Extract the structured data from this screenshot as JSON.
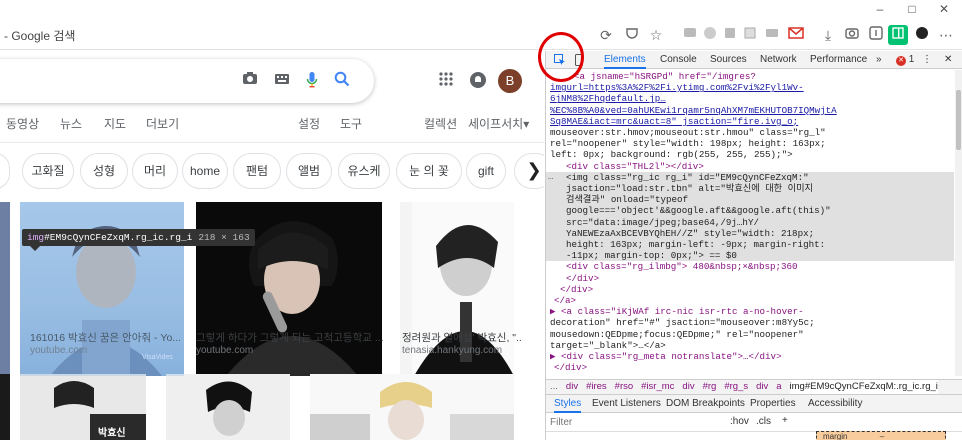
{
  "browser": {
    "url_text": "- Google 검색",
    "window_controls": [
      "–",
      "□",
      "✕"
    ]
  },
  "google": {
    "tabs": [
      "동영상",
      "뉴스",
      "지도",
      "더보기",
      "설정",
      "도구",
      "컬렉션",
      "세이프서치"
    ],
    "safesearch_arrow": "▾",
    "avatar_letter": "B",
    "chips": [
      "고화질",
      "성형",
      "머리",
      "home",
      "팬텀",
      "앨범",
      "유스케",
      "눈 의 꽃",
      "gift"
    ],
    "chip_next": "❯",
    "results": [
      {
        "caption": "161016 박효신 꿈은 안아줘 - Yo...",
        "source": "youtube.com",
        "thumb_label": "VisaVides"
      },
      {
        "caption": "그렇게 하다가 그렇게 되는 고척고등학교 ...",
        "source": "youtube.com"
      },
      {
        "caption": "정려원과 열애설' 박효신, \"...",
        "source": "tenasia.hankyung.com"
      }
    ],
    "bottom_thumb_label": "박효신",
    "tooltip": {
      "tag": "img",
      "id": "#EM9cQynCFeZxqM",
      "cls": ".rg_ic.rg_i",
      "size": "218 × 163"
    }
  },
  "devtools": {
    "tabs": [
      "Elements",
      "Console",
      "Sources",
      "Network",
      "Performance"
    ],
    "more": "»",
    "error_count": "1",
    "error_icon": "✕",
    "dom_lines": [
      {
        "kind": "a_open_1",
        "text": "<a jsname=\"hSRGPd\" href=\"/imgres?"
      },
      {
        "kind": "link",
        "text": "imgurl=https%3A%2F%2Fi.ytimg.com%2Fvi%2Fyl1Wv-"
      },
      {
        "kind": "link",
        "text": "6jNM8%2Fhqdefault.jp…"
      },
      {
        "kind": "link",
        "text": "%EC%8B%A0&ved=0ahUKEwi1rqamr5nqAhXM7mEKHUTOB7IQMwjtA"
      },
      {
        "kind": "link_tail",
        "text": "Sq8MAE&iact=mrc&uact=8\" jsaction=\"fire.ivg_o;"
      },
      {
        "kind": "plain",
        "text": "mouseover:str.hmov;mouseout:str.hmou\" class=\"rg_l\""
      },
      {
        "kind": "plain",
        "text": "rel=\"noopener\" style=\"width: 198px; height: 163px;"
      },
      {
        "kind": "plain",
        "text": "left: 0px; background: rgb(255, 255, 255);\">"
      },
      {
        "kind": "div",
        "text": "<div class=\"THL2l\"></div>"
      },
      {
        "kind": "sel",
        "text": "<img class=\"rg_ic rg_i\" id=\"EM9cQynCFeZxqM:\""
      },
      {
        "kind": "sel",
        "text": "jsaction=\"load:str.tbn\" alt=\"박효신에 대한 이미지"
      },
      {
        "kind": "sel",
        "text": "검색결과\" onload=\"typeof"
      },
      {
        "kind": "sel",
        "text": "google==='object'&&google.aft&&google.aft(this)\""
      },
      {
        "kind": "sel",
        "text": "src=\"data:image/jpeg;base64,/9j…hY/"
      },
      {
        "kind": "sel",
        "text": "YaNEWEzaAxBCEVBYQhEH//Z\" style=\"width: 218px;"
      },
      {
        "kind": "sel",
        "text": "height: 163px; margin-left: -9px; margin-right:"
      },
      {
        "kind": "sel",
        "text": "-11px; margin-top: 0px;\"> == $0"
      },
      {
        "kind": "div",
        "text": "<div class=\"rg_ilmbg\"> 480&nbsp;×&nbsp;360"
      },
      {
        "kind": "close",
        "text": "</div>"
      },
      {
        "kind": "close2",
        "text": "</div>"
      },
      {
        "kind": "close3",
        "text": "</a>"
      },
      {
        "kind": "a2",
        "text": "▶ <a class=\"iKjWAf irc-nic isr-rtc a-no-hover-"
      },
      {
        "kind": "plain2",
        "text": "decoration\" href=\"#\" jsaction=\"mouseover:m8Yy5c;"
      },
      {
        "kind": "plain2",
        "text": "mousedown:QEDpme;focus:QEDpme;\" rel=\"noopener\""
      },
      {
        "kind": "plain2",
        "text": "target=\"_blank\">…</a>"
      },
      {
        "kind": "a2",
        "text": "▶ <div class=\"rg_meta notranslate\">…</div>"
      },
      {
        "kind": "close3",
        "text": "</div>"
      }
    ],
    "breadcrumbs": [
      "...",
      "div",
      "#ires",
      "#rso",
      "#isr_mc",
      "div",
      "#rg",
      "#rg_s",
      "div",
      "a",
      "img#EM9cQynCFeZxqM:.rg_ic.rg_i"
    ],
    "bottom_tabs": [
      "Styles",
      "Event Listeners",
      "DOM Breakpoints",
      "Properties",
      "Accessibility"
    ],
    "filter_placeholder": "Filter",
    "filter_hov": ":hov",
    "filter_cls": ".cls",
    "filter_plus": "+",
    "box_label": "margin",
    "box_value": "–"
  },
  "colors": {
    "highlight_overlay": "#9ec5e8",
    "annotation_circle": "#e00000",
    "gmail_red": "#d93025",
    "ext_green": "#00c271"
  }
}
